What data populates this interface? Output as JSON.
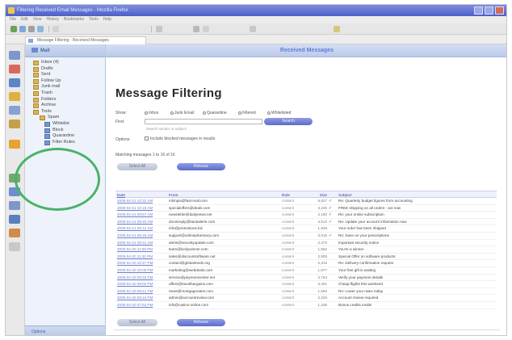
{
  "window": {
    "title": "Filtering Received Email Messages - Mozilla Firefox"
  },
  "menu": [
    "File",
    "Edit",
    "View",
    "History",
    "Bookmarks",
    "Tools",
    "Help"
  ],
  "tab": {
    "label": "Message Filtering - Received Messages"
  },
  "folders": {
    "header": "Mail",
    "items": [
      {
        "label": "Inbox (4)",
        "level": 0
      },
      {
        "label": "Drafts",
        "level": 0
      },
      {
        "label": "Sent",
        "level": 0
      },
      {
        "label": "Follow Up",
        "level": 0
      },
      {
        "label": "Junk mail",
        "level": 0
      },
      {
        "label": "Trash",
        "level": 0
      },
      {
        "label": "Folders",
        "level": 0
      },
      {
        "label": "Archive",
        "level": 0
      },
      {
        "label": "Tools",
        "level": 0
      },
      {
        "label": "Spam",
        "level": 1
      },
      {
        "label": "Whitelist",
        "level": 2
      },
      {
        "label": "Block",
        "level": 2
      },
      {
        "label": "Quarantine",
        "level": 2
      },
      {
        "label": "Filter Rules",
        "level": 2
      }
    ],
    "footer": "Options"
  },
  "main": {
    "header": "Received Messages",
    "title": "Message Filtering",
    "show_label": "Show:",
    "radios": [
      "Inbox",
      "Junk Email",
      "Quarantine",
      "Filtered",
      "Whitelisted"
    ],
    "find_label": "Find:",
    "find_value": "",
    "find_hint": "Search sender or subject",
    "search_button": "Search",
    "options_label": "Options:",
    "options_checkbox": "Include blocked messages in results",
    "count_text": "Matching messages 1 to 16 of 16",
    "top_buttons": [
      "Select All",
      "Release"
    ],
    "bottom_buttons": [
      "Select All",
      "Release"
    ]
  },
  "table": {
    "headers": [
      "Date",
      "From",
      "Rule",
      "Size",
      "",
      "Subject"
    ],
    "rows": [
      {
        "date": "2005-04-21 10:32 AM",
        "from": "mlimpia@fast-mail.com",
        "rule": "content",
        "size": "5,827",
        "clip": "attached",
        "subject": "Re: Quarterly budget figures from accounting"
      },
      {
        "date": "2005-04-21 10:18 AM",
        "from": "specialoffers@deals.com",
        "rule": "content",
        "size": "3,245",
        "clip": "attached",
        "subject": "FREE shipping on all orders - act now"
      },
      {
        "date": "2005-04-21 09:57 AM",
        "from": "newsletter@dailynews.net",
        "rule": "content",
        "size": "2,180",
        "clip": "attached",
        "subject": "Re: your online subscription"
      },
      {
        "date": "2005-04-21 09:40 AM",
        "from": "donotreply@bankalerts.com",
        "rule": "content",
        "size": "4,512",
        "clip": "attached",
        "subject": "Re: Update your account information now"
      },
      {
        "date": "2005-04-21 09:12 AM",
        "from": "info@promotions.biz",
        "rule": "content",
        "size": "1,948",
        "clip": "",
        "subject": "Your order has been shipped"
      },
      {
        "date": "2005-04-21 08:46 AM",
        "from": "support@onlinepharmacy.com",
        "rule": "content",
        "size": "3,016",
        "clip": "attached",
        "subject": "Re: Save on your prescriptions"
      },
      {
        "date": "2005-04-21 08:21 AM",
        "from": "alerts@securityupdate.com",
        "rule": "content",
        "size": "2,473",
        "clip": "",
        "subject": "Important security notice"
      },
      {
        "date": "2005-04-20 11:58 PM",
        "from": "team@luckywinner.com",
        "rule": "content",
        "size": "1,662",
        "clip": "",
        "subject": "You're a winner"
      },
      {
        "date": "2005-04-20 11:30 PM",
        "from": "sales@discountsoftware.net",
        "rule": "content",
        "size": "2,905",
        "clip": "",
        "subject": "Special Offer on software products"
      },
      {
        "date": "2005-04-20 10:47 PM",
        "from": "contact@globalmeds.org",
        "rule": "content",
        "size": "2,318",
        "clip": "",
        "subject": "Re: Delivery confirmation request"
      },
      {
        "date": "2005-04-20 10:05 PM",
        "from": "marketing@webdeals.com",
        "rule": "content",
        "size": "1,877",
        "clip": "",
        "subject": "Your free gift is waiting"
      },
      {
        "date": "2005-04-20 09:33 PM",
        "from": "service@paymentcenter.net",
        "rule": "content",
        "size": "2,764",
        "clip": "",
        "subject": "Verify your payment details"
      },
      {
        "date": "2005-04-20 09:02 PM",
        "from": "offers@travelbargains.com",
        "rule": "content",
        "size": "3,401",
        "clip": "",
        "subject": "Cheap flights this weekend"
      },
      {
        "date": "2005-04-20 08:41 PM",
        "from": "news@mortgagerates.com",
        "rule": "content",
        "size": "1,593",
        "clip": "",
        "subject": "Re: Lower your rates today"
      },
      {
        "date": "2005-04-20 08:15 PM",
        "from": "admin@accountreview.com",
        "rule": "content",
        "size": "2,226",
        "clip": "",
        "subject": "Account review required"
      },
      {
        "date": "2005-04-20 07:52 PM",
        "from": "info@casino-online.com",
        "rule": "content",
        "size": "1,438",
        "clip": "",
        "subject": "Bonus credits inside"
      }
    ]
  },
  "colors": {
    "accent": "#5d6cc9",
    "header_text": "#5d7fd6",
    "highlight_ring": "#49b36a"
  }
}
